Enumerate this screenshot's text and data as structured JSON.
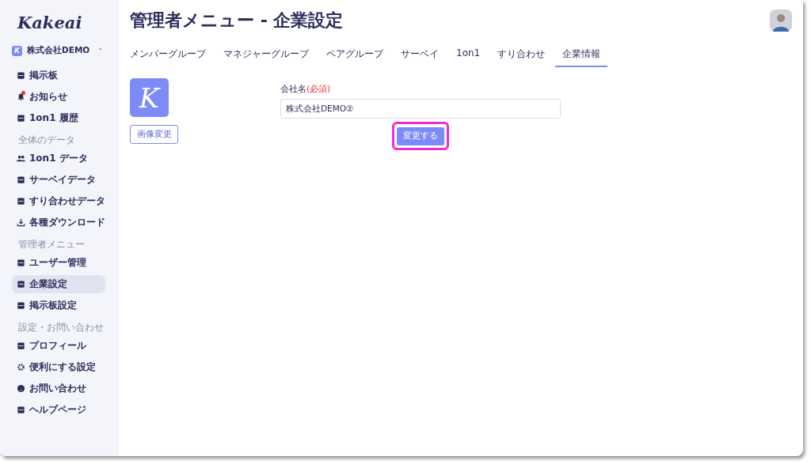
{
  "logo": "Kakeai",
  "company_switcher": {
    "badge": "K",
    "name": "株式会社DEMO",
    "caret": "⌃"
  },
  "sidebar": {
    "groups": [
      {
        "items": [
          {
            "label": "掲示板",
            "selected": false,
            "dot": false
          },
          {
            "label": "お知らせ",
            "selected": false,
            "dot": true
          },
          {
            "label": "1on1 履歴",
            "selected": false,
            "dot": false
          }
        ]
      },
      {
        "heading": "全体のデータ",
        "items": [
          {
            "label": "1on1 データ",
            "selected": false,
            "dot": false
          },
          {
            "label": "サーベイデータ",
            "selected": false,
            "dot": false
          },
          {
            "label": "すり合わせデータ",
            "selected": false,
            "dot": false
          },
          {
            "label": "各種ダウンロード",
            "selected": false,
            "dot": false
          }
        ]
      },
      {
        "heading": "管理者メニュー",
        "items": [
          {
            "label": "ユーザー管理",
            "selected": false,
            "dot": false
          },
          {
            "label": "企業設定",
            "selected": true,
            "dot": false
          },
          {
            "label": "掲示板設定",
            "selected": false,
            "dot": false
          }
        ]
      },
      {
        "heading": "設定・お問い合わせ",
        "items": [
          {
            "label": "プロフィール",
            "selected": false,
            "dot": false
          },
          {
            "label": "便利にする設定",
            "selected": false,
            "dot": false
          },
          {
            "label": "お問い合わせ",
            "selected": false,
            "dot": false
          },
          {
            "label": "ヘルプページ",
            "selected": false,
            "dot": false
          }
        ]
      }
    ]
  },
  "page_title": "管理者メニュー - 企業設定",
  "tabs": [
    {
      "label": "メンバーグループ",
      "selected": false
    },
    {
      "label": "マネジャーグループ",
      "selected": false
    },
    {
      "label": "ペアグループ",
      "selected": false
    },
    {
      "label": "サーベイ",
      "selected": false
    },
    {
      "label": "1on1",
      "selected": false
    },
    {
      "label": "すり合わせ",
      "selected": false
    },
    {
      "label": "企業情報",
      "selected": true
    }
  ],
  "company_logo": {
    "letter": "K"
  },
  "change_image_button": "画像変更",
  "form": {
    "label": "会社名",
    "required": "(必須)",
    "value": "株式会社DEMO②"
  },
  "submit_button": {
    "label": "変更する",
    "highlighted": true
  }
}
